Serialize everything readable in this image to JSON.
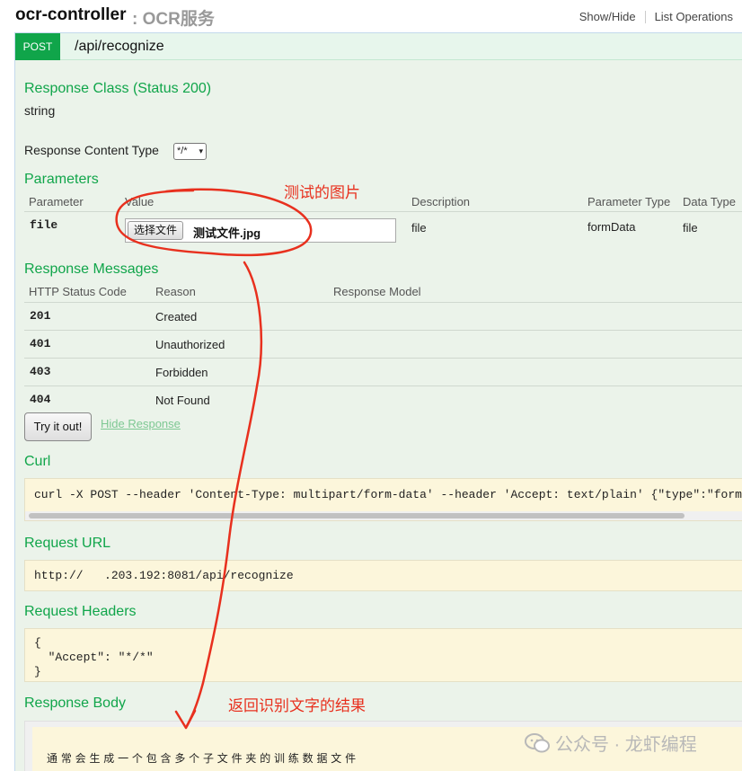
{
  "header": {
    "controller": "ocr-controller",
    "description": ": OCR服务",
    "links": [
      "Show/Hide",
      "List Operations"
    ]
  },
  "operation": {
    "method": "POST",
    "path": "/api/recognize"
  },
  "response_class": {
    "title": "Response Class (Status 200)",
    "value": "string"
  },
  "content_type": {
    "label": "Response Content Type",
    "selected": "*/*"
  },
  "parameters": {
    "title": "Parameters",
    "headers": [
      "Parameter",
      "Value",
      "Description",
      "Parameter Type",
      "Data Type"
    ],
    "row": {
      "name": "file",
      "button": "选择文件",
      "filename": "测试文件.jpg",
      "description": "file",
      "param_type": "formData",
      "data_type": "file"
    }
  },
  "response_messages": {
    "title": "Response Messages",
    "headers": [
      "HTTP Status Code",
      "Reason",
      "Response Model"
    ],
    "rows": [
      {
        "code": "201",
        "reason": "Created"
      },
      {
        "code": "401",
        "reason": "Unauthorized"
      },
      {
        "code": "403",
        "reason": "Forbidden"
      },
      {
        "code": "404",
        "reason": "Not Found"
      }
    ]
  },
  "actions": {
    "try": "Try it out!",
    "hide": "Hide Response"
  },
  "curl": {
    "title": "Curl",
    "command": "curl -X POST --header 'Content-Type: multipart/form-data' --header 'Accept: text/plain' {\"type\":\"form"
  },
  "request_url": {
    "title": "Request URL",
    "value": "http://   .203.192:8081/api/recognize"
  },
  "request_headers": {
    "title": "Request Headers",
    "line1": "{",
    "line2": "  \"Accept\": \"*/*\"",
    "line3": "}"
  },
  "response_body": {
    "title": "Response Body",
    "text": "通 常 会 生 成 一 个 包 含 多 个 子 文 件 夹 的 训 练 数 据 文 件"
  },
  "annotations": {
    "image_note": "测试的图片",
    "result_note": "返回识别文字的结果"
  },
  "watermark": "公众号 · 龙虾编程",
  "colors": {
    "post_green": "#10a54a",
    "annotation_red": "#e8301e",
    "panel_bg": "#ebf3ea",
    "code_bg": "#fcf6db"
  }
}
